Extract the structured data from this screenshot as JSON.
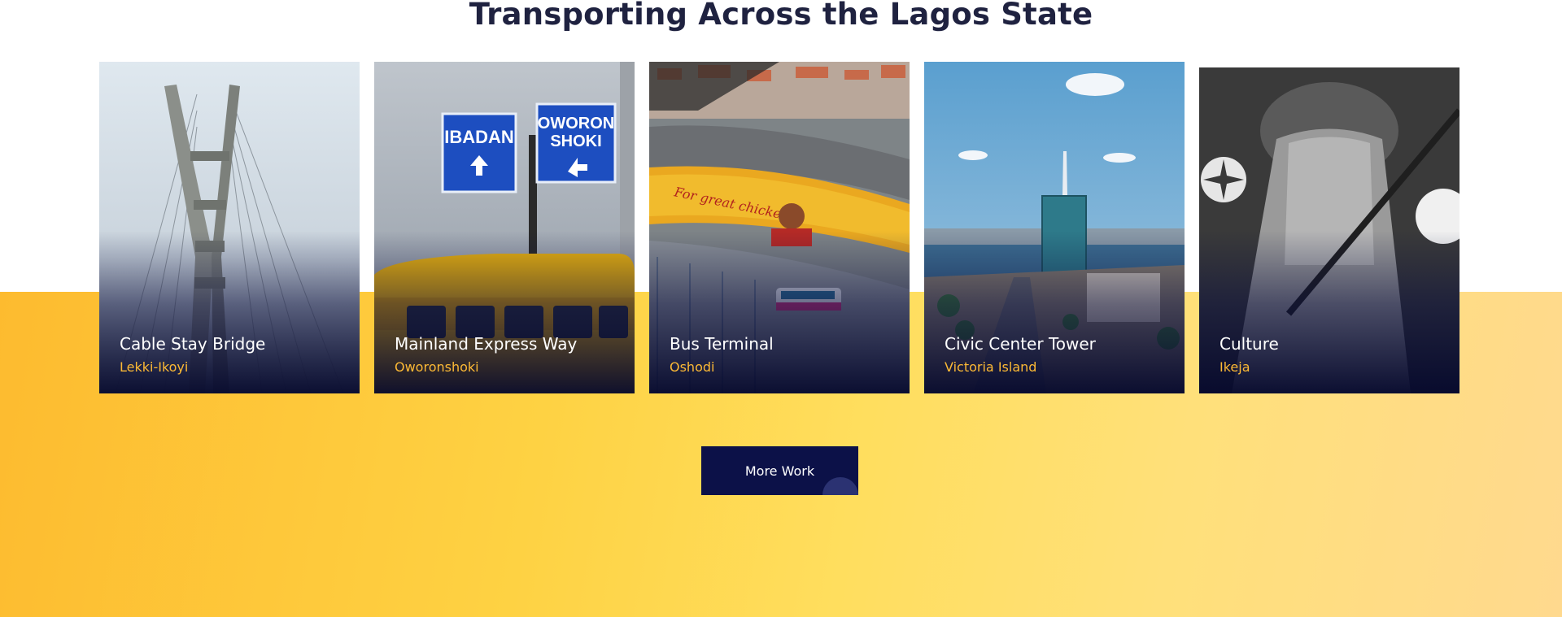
{
  "section": {
    "title": "Transporting Across the Lagos State"
  },
  "cards": [
    {
      "title": "Cable Stay Bridge",
      "subtitle": "Lekki-Ikoyi"
    },
    {
      "title": "Mainland Express Way",
      "subtitle": "Oworonshoki"
    },
    {
      "title": "Bus Terminal",
      "subtitle": "Oshodi"
    },
    {
      "title": "Civic Center Tower",
      "subtitle": "Victoria Island"
    },
    {
      "title": "Culture",
      "subtitle": "Ikeja"
    }
  ],
  "signs": {
    "left_top": "IBADAN",
    "right_line1": "OWORON",
    "right_line2": "SHOKI"
  },
  "billboard_text": "For great chicken",
  "more_button": {
    "label": "More Work"
  },
  "colors": {
    "heading": "#1f2240",
    "accent_yellow": "#fcb935",
    "button_bg": "#0c1148",
    "band_start": "#fdbb2f",
    "band_end": "#ffd98e"
  }
}
